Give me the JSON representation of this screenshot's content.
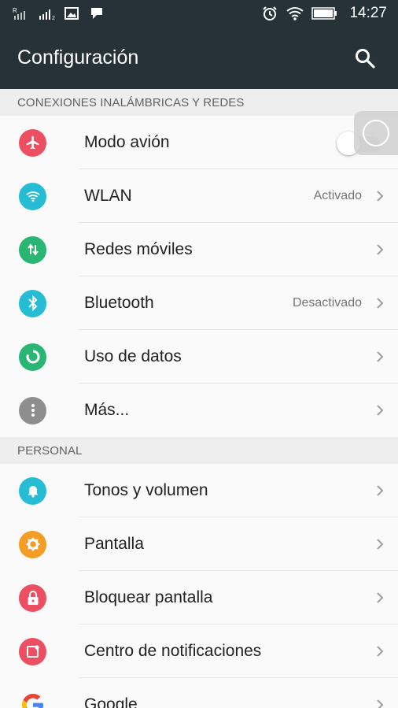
{
  "status_bar": {
    "time": "14:27",
    "icons_left": [
      "signal-r-icon",
      "signal-2-icon",
      "image-notification-icon",
      "message-notification-icon"
    ],
    "icons_right": [
      "alarm-icon",
      "wifi-icon",
      "battery-icon"
    ]
  },
  "app_bar": {
    "title": "Configuración",
    "search_icon": "search-icon"
  },
  "sections": [
    {
      "header": "CONEXIONES INALÁMBRICAS Y REDES",
      "items": [
        {
          "label": "Modo avión",
          "icon": "airplane-icon",
          "color": "#ec4f62",
          "control": "toggle",
          "toggle_on": false
        },
        {
          "label": "WLAN",
          "icon": "wifi-icon",
          "color": "#25bcd4",
          "status": "Activado"
        },
        {
          "label": "Redes móviles",
          "icon": "mobile-data-icon",
          "color": "#28b672"
        },
        {
          "label": "Bluetooth",
          "icon": "bluetooth-icon",
          "color": "#25bcd4",
          "status": "Desactivado"
        },
        {
          "label": "Uso de datos",
          "icon": "data-usage-icon",
          "color": "#28b672"
        },
        {
          "label": "Más...",
          "icon": "more-icon",
          "color": "#8e8e8e"
        }
      ]
    },
    {
      "header": "PERSONAL",
      "items": [
        {
          "label": "Tonos y volumen",
          "icon": "bell-icon",
          "color": "#25bcd4"
        },
        {
          "label": "Pantalla",
          "icon": "brightness-icon",
          "color": "#f39c26"
        },
        {
          "label": "Bloquear pantalla",
          "icon": "lock-icon",
          "color": "#ec4f62"
        },
        {
          "label": "Centro de notificaciones",
          "icon": "notification-center-icon",
          "color": "#ec4f62"
        },
        {
          "label": "Google",
          "icon": "google-icon",
          "color": "#4285f4"
        }
      ]
    }
  ]
}
